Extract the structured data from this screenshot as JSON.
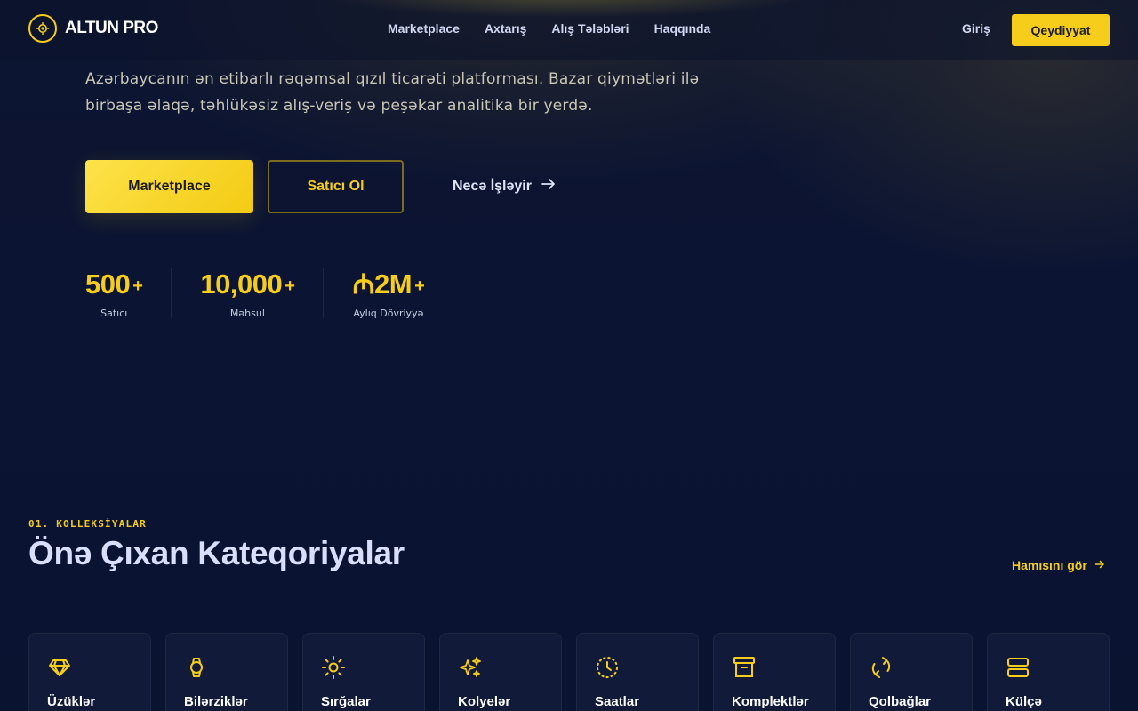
{
  "header": {
    "brand": "ALTUN PRO",
    "nav": [
      "Marketplace",
      "Axtarış",
      "Alış Tələbləri",
      "Haqqında"
    ],
    "login_label": "Giriş",
    "register_label": "Qeydiyyat"
  },
  "hero": {
    "description_line1": "Azərbaycanın ən etibarlı rəqəmsal qızıl ticarəti platforması. Bazar qiymətləri ilə",
    "description_line2": "birbaşa əlaqə, təhlükəsiz alış-veriş və peşəkar analitika bir yerdə.",
    "primary_button": "Marketplace",
    "secondary_button": "Satıcı Ol",
    "link_button": "Necə İşləyir"
  },
  "stats": [
    {
      "value": "500",
      "suffix": "+",
      "label": "Satıcı"
    },
    {
      "value": "10,000",
      "suffix": "+",
      "label": "Məhsul"
    },
    {
      "value": "₼2M",
      "suffix": "+",
      "label": "Aylıq Dövriyyə"
    }
  ],
  "categories_section": {
    "kicker": "01. KOLLEKSİYALAR",
    "title": "Önə Çıxan Kateqoriyalar",
    "see_all": "Hamısını gör",
    "items": [
      {
        "label": "Üzüklər",
        "icon": "diamond-icon"
      },
      {
        "label": "Bilərziklər",
        "icon": "watch-icon"
      },
      {
        "label": "Sırğalar",
        "icon": "sun-icon"
      },
      {
        "label": "Kolyelər",
        "icon": "sparkles-icon"
      },
      {
        "label": "Saatlar",
        "icon": "clock-icon"
      },
      {
        "label": "Komplektlər",
        "icon": "archive-box-icon"
      },
      {
        "label": "Qolbağlar",
        "icon": "refresh-icon"
      },
      {
        "label": "Külçə",
        "icon": "bars-icon"
      }
    ]
  },
  "colors": {
    "accent": "#f5cd1a",
    "background": "#0b1330",
    "card": "#111a38"
  }
}
